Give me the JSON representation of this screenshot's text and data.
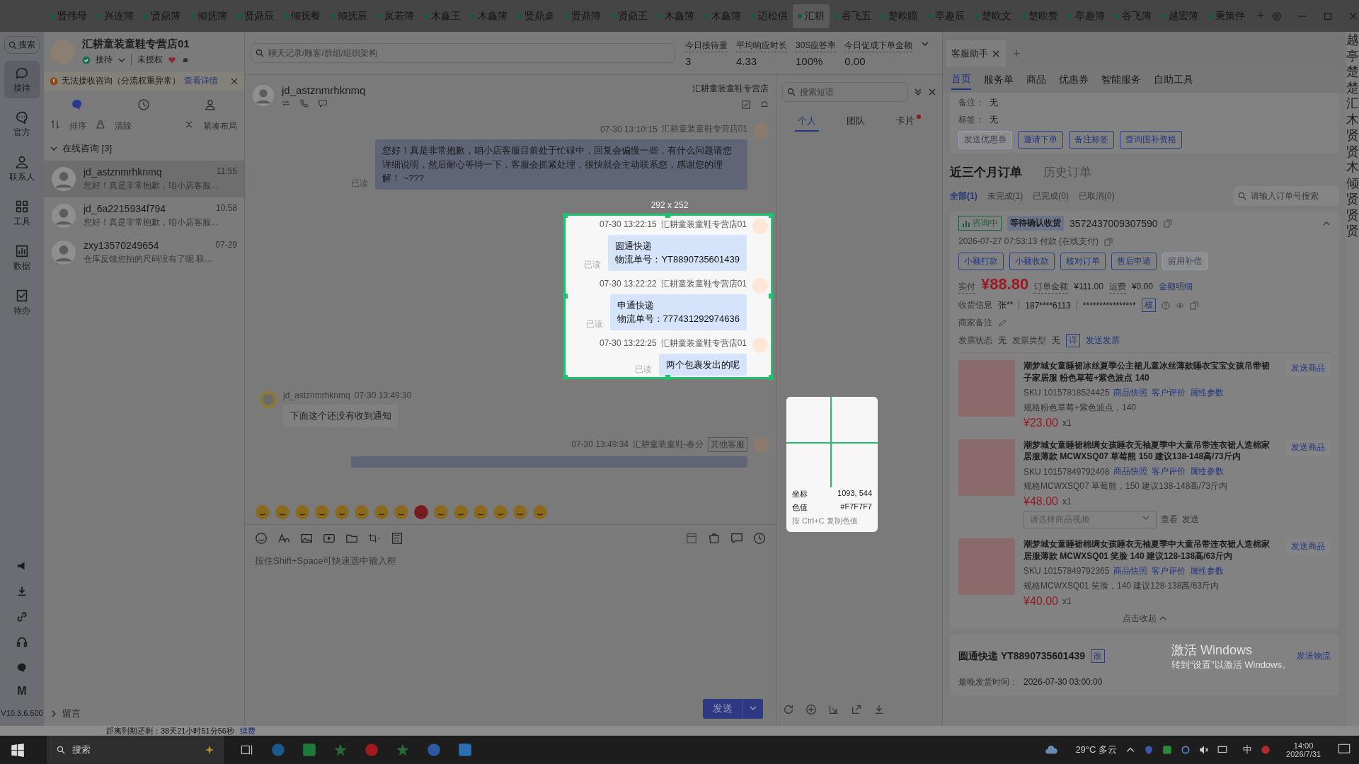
{
  "top_tabs": [
    {
      "label": "贤伟母",
      "selected": false
    },
    {
      "label": "兴连簿",
      "selected": false
    },
    {
      "label": "贤鼎簿",
      "selected": false
    },
    {
      "label": "倾抚簿",
      "selected": false
    },
    {
      "label": "贤鼎辰",
      "selected": false
    },
    {
      "label": "倾抚餐",
      "selected": false
    },
    {
      "label": "倾抚辰",
      "selected": false
    },
    {
      "label": "岚若簿",
      "selected": false
    },
    {
      "label": "木鑫王",
      "selected": false
    },
    {
      "label": "木鑫簿",
      "selected": false
    },
    {
      "label": "贤鼎桌",
      "selected": false
    },
    {
      "label": "贤鼎簿",
      "selected": false
    },
    {
      "label": "贤鼎王",
      "selected": false
    },
    {
      "label": "木鑫簿",
      "selected": false
    },
    {
      "label": "木鑫簿",
      "selected": false
    },
    {
      "label": "迈松供",
      "selected": false
    },
    {
      "label": "汇耕",
      "selected": true
    },
    {
      "label": "谷飞五",
      "selected": false
    },
    {
      "label": "楚欧瞳",
      "selected": false
    },
    {
      "label": "亭趣辰",
      "selected": false
    },
    {
      "label": "楚欧文",
      "selected": false
    },
    {
      "label": "楚欧赞",
      "selected": false
    },
    {
      "label": "亭趣簿",
      "selected": false
    },
    {
      "label": "谷飞簿",
      "selected": false
    },
    {
      "label": "越宏簿",
      "selected": false
    },
    {
      "label": "秉策伴",
      "selected": false
    }
  ],
  "add_tab": "+",
  "nav": {
    "search": "搜索",
    "items": [
      {
        "label": "接待",
        "kind": "chat",
        "selected": true
      },
      {
        "label": "官方",
        "kind": "bubble",
        "selected": false
      },
      {
        "label": "联系人",
        "kind": "person",
        "selected": false
      },
      {
        "label": "工具",
        "kind": "grid",
        "selected": false
      },
      {
        "label": "数据",
        "kind": "chart",
        "selected": false
      },
      {
        "label": "待办",
        "kind": "todo",
        "selected": false
      }
    ],
    "letter": "M",
    "version": "V10.3.6.500"
  },
  "shop": {
    "name": "汇耕童装童鞋专营店01",
    "status": "接待",
    "auth": "未授权"
  },
  "alert": {
    "text": "无法接收咨询（分流权重异常）",
    "link": "查看详情"
  },
  "list_tools": {
    "sort": "排序",
    "clear": "清除",
    "compact": "紧凑布局"
  },
  "group": {
    "label": "在线咨询 [3]",
    "expanded": true
  },
  "conversations": [
    {
      "name": "jd_astznmrhknmq",
      "time": "11:55",
      "preview": "您好！真是非常抱歉，咱小店客服...",
      "selected": true
    },
    {
      "name": "jd_6a2215934f794",
      "time": "10:58",
      "preview": "您好！真是非常抱歉，咱小店客服...",
      "selected": false
    },
    {
      "name": "zxy13570249654",
      "time": "07-29",
      "preview": "仓库反馈您拍的尺码没有了呢 联...",
      "selected": false
    }
  ],
  "leave_message": "留言",
  "search": {
    "placeholder": "聊天记录/顾客/群组/组织架构"
  },
  "stats": [
    {
      "label": "今日接待量",
      "value": "3"
    },
    {
      "label": "平均响应时长",
      "value": "4.33"
    },
    {
      "label": "30S应答率",
      "value": "100%"
    },
    {
      "label": "今日促成下单金额",
      "value": "0.00"
    }
  ],
  "chat": {
    "customer": "jd_astznmrhknmq",
    "shop": "汇耕童装童鞋专营店",
    "messages": [
      {
        "kind": "outgoing",
        "time": "07-30 13:10:15",
        "sender": "汇耕童装童鞋专营店01",
        "lines": [
          "您好！真是非常抱歉，咱小店客服目前处于忙碌中，回复会偏慢一些，有什么问题请您详细说明，然后耐心等待一下，客服会抓紧处理，很快就会主动联系您，感谢您的理解！ ~???"
        ],
        "read": "已读",
        "captured": false
      },
      {
        "kind": "outgoing",
        "time": "07-30 13:22:15",
        "sender": "汇耕童装童鞋专营店01",
        "lines": [
          "圆通快递",
          "物流单号：YT8890735601439"
        ],
        "read": "已读",
        "captured": true
      },
      {
        "kind": "outgoing",
        "time": "07-30 13:22:22",
        "sender": "汇耕童装童鞋专营店01",
        "lines": [
          "申通快递",
          "物流单号：777431292974636"
        ],
        "read": "已读",
        "captured": true
      },
      {
        "kind": "outgoing",
        "time": "07-30 13:22:25",
        "sender": "汇耕童装童鞋专营店01",
        "lines": [
          "两个包裹发出的呢"
        ],
        "read": "已读",
        "captured": true
      },
      {
        "kind": "incoming",
        "time": "07-30 13:49:30",
        "sender": "jd_astznmrhknmq",
        "lines": [
          "下面这个还没有收到通知"
        ],
        "captured": false
      },
      {
        "kind": "outgoing",
        "time": "07-30 13:49:34",
        "sender": "汇耕童装童鞋-春分",
        "tag": "其他客服",
        "captured": false
      }
    ],
    "input_placeholder": "按住Shift+Space可快速选中输入框",
    "send": "发送"
  },
  "quick": {
    "placeholder": "搜索短语",
    "tabs": [
      {
        "label": "个人",
        "selected": true,
        "dot": false
      },
      {
        "label": "团队",
        "selected": false,
        "dot": false
      },
      {
        "label": "卡片",
        "selected": false,
        "dot": true
      }
    ]
  },
  "assistant": {
    "tab": "客服助手",
    "add": "+",
    "nav": [
      {
        "label": "首页",
        "selected": true
      },
      {
        "label": "服务单",
        "selected": false
      },
      {
        "label": "商品",
        "selected": false
      },
      {
        "label": "优惠券",
        "selected": false
      },
      {
        "label": "智能服务",
        "selected": false
      },
      {
        "label": "自助工具",
        "selected": false
      }
    ],
    "info": [
      {
        "label": "备注：",
        "value": "无"
      },
      {
        "label": "标签：",
        "value": "无"
      }
    ],
    "buttons": [
      {
        "label": "发送优惠券",
        "disabled": true
      },
      {
        "label": "邀请下单",
        "disabled": false
      },
      {
        "label": "备注标签",
        "disabled": false
      },
      {
        "label": "查询国补资格",
        "disabled": false
      }
    ],
    "order_tabs": [
      {
        "label": "近三个月订单",
        "selected": true
      },
      {
        "label": "历史订单",
        "selected": false
      }
    ],
    "filters": [
      {
        "label": "全部(1)",
        "selected": true
      },
      {
        "label": "未完成(1)",
        "selected": false
      },
      {
        "label": "已完成(0)",
        "selected": false
      },
      {
        "label": "已取消(0)",
        "selected": false
      }
    ],
    "order_search": {
      "placeholder": "请输入订单号搜索"
    },
    "order": {
      "consult": "咨询中",
      "state": "等待确认收货",
      "id": "3572437009307590",
      "paid_time": "2026-07-27 07:53:13  付款  (在线支付)",
      "actions": [
        {
          "label": "小额打款",
          "disabled": false
        },
        {
          "label": "小额收款",
          "disabled": false
        },
        {
          "label": "核对订单",
          "disabled": false
        },
        {
          "label": "售后申请",
          "disabled": false
        },
        {
          "label": "留用补偿",
          "disabled": true
        }
      ],
      "paid_label": "实付",
      "paid": "¥88.80",
      "amount_label": "订单金额",
      "amount": "¥111.00",
      "ship_label": "运费",
      "ship": "¥0.00",
      "detail_link": "金额明细",
      "receiver_label": "收货信息",
      "receiver": "张**",
      "phone": "187****6113",
      "address": "****************",
      "verify": "核",
      "note_label": "商家备注",
      "invoice_status_label": "发票状态",
      "invoice_status": "无",
      "invoice_type_label": "发票类型",
      "invoice_type": "无",
      "invoice_detail": "详",
      "invoice_send": "发送发票"
    },
    "products": [
      {
        "title": "潮梦城女童睡裙冰丝夏季公主裙儿童冰丝薄款睡衣宝宝女孩吊带裙子家居服 粉色草莓+紫色波点 140",
        "sku": "SKU 10157818524425",
        "links": [
          "商品快照",
          "客户评价",
          "属性参数"
        ],
        "spec": "规格粉色草莓+紫色波点，140",
        "price": "¥23.00",
        "qty": "x1",
        "send": "发送商品"
      },
      {
        "title": "潮梦城女童睡裙棉绸女孩睡衣无袖夏季中大童吊带连衣裙人造棉家居服薄款 MCWXSQ07 草莓熊 150 建议138-148高/73斤内",
        "sku": "SKU 10157849792408",
        "links": [
          "商品快照",
          "客户评价",
          "属性参数"
        ],
        "spec": "规格MCWXSQ07 草莓熊，150 建议138-148高/73斤内",
        "price": "¥48.00",
        "qty": "x1",
        "send": "发送商品",
        "video": {
          "placeholder": "请选择商品视频",
          "view": "查看",
          "send": "发送"
        }
      },
      {
        "title": "潮梦城女童睡裙棉绸女孩睡衣无袖夏季中大童吊带连衣裙人造棉家居服薄款 MCWXSQ01 笑脸 140 建议128-138高/63斤内",
        "sku": "SKU 10157849792365",
        "links": [
          "商品快照",
          "客户评价",
          "属性参数"
        ],
        "spec": "规格MCWXSQ01 笑脸，140 建议128-138高/63斤内",
        "price": "¥40.00",
        "qty": "x1",
        "send": "发送商品"
      }
    ],
    "collapse": "点击收起",
    "shipping": {
      "carrier": "圆通快递 YT8890735601439",
      "edit": "改",
      "send": "发送物流",
      "time_label": "最晚发货时间：",
      "time": "2026-07-30 03:00:00"
    }
  },
  "edge_chars": "越亭楚楚汇木贤贤木倾贤贤贤",
  "windows_notice": {
    "title": "激活 Windows",
    "hint": "转到“设置”以激活 Windows。"
  },
  "capture": {
    "size": "292 x 252",
    "coord_label": "坐标",
    "coord": "1093, 544",
    "color_label": "色值",
    "hex_value": "#F7F7F7",
    "hint": "按 Ctrl+C 复制色值"
  },
  "expiry": {
    "text": "距离到期还剩：38天21小时51分56秒",
    "link": "续费"
  },
  "taskbar": {
    "search": "搜索",
    "weather": "29°C 多云",
    "ime": "中",
    "time": "14:00",
    "date": "2026/7/31"
  }
}
